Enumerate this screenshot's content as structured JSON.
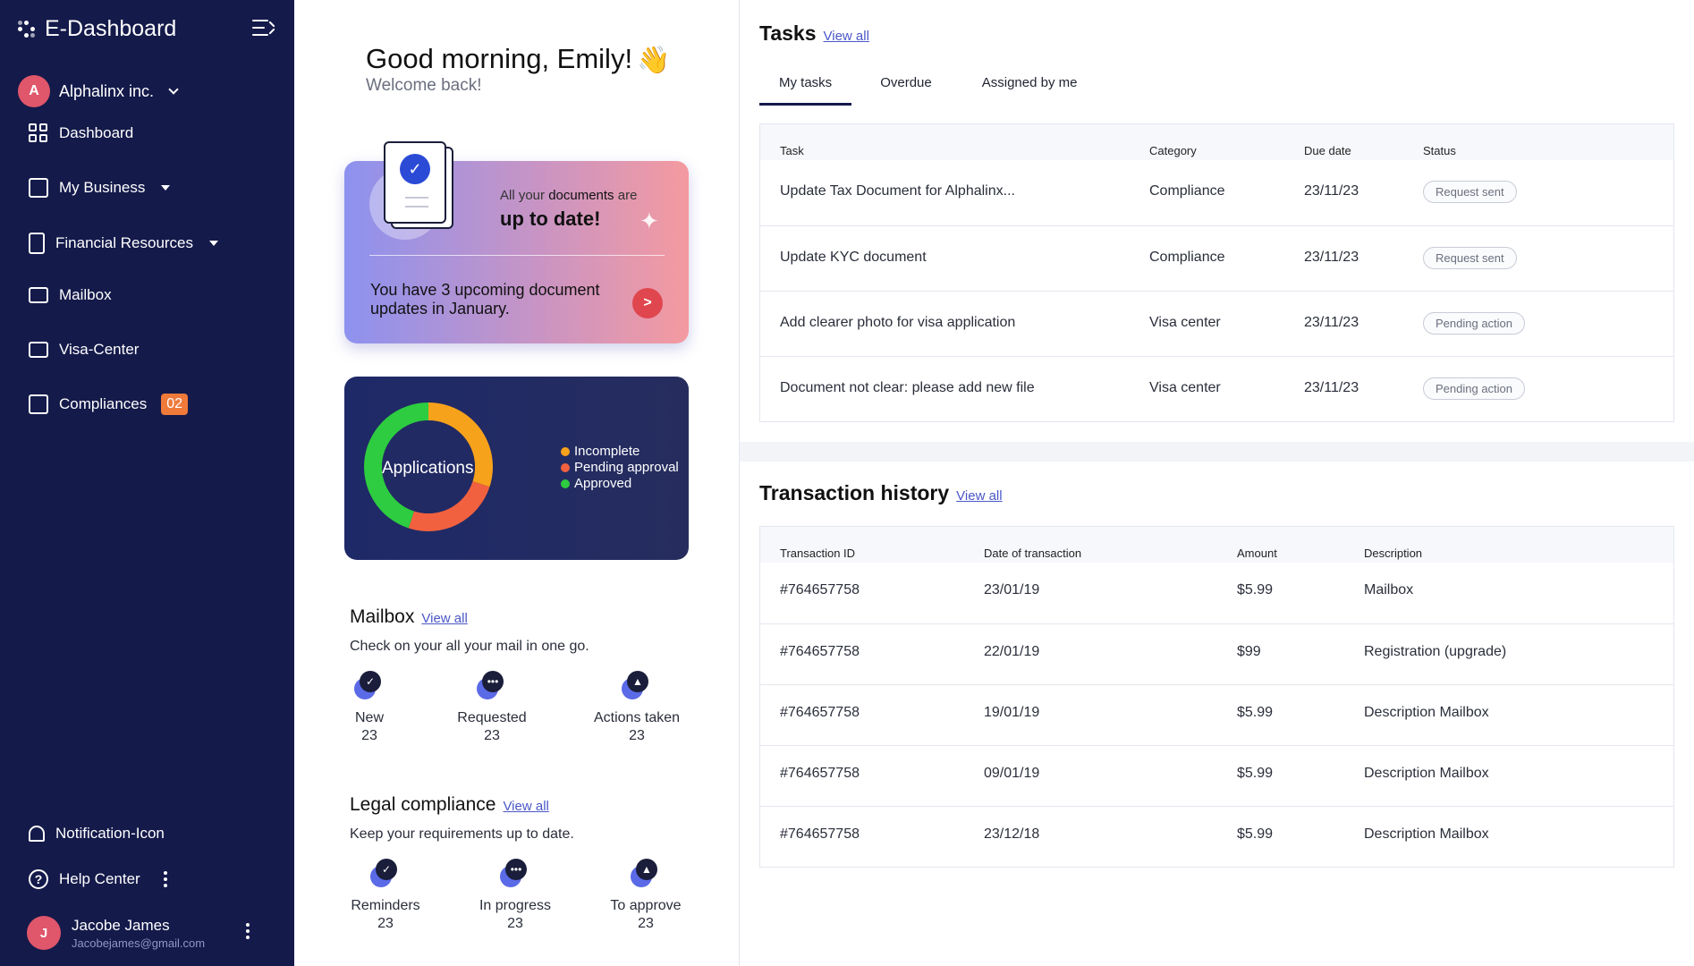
{
  "app": {
    "title": "E-Dashboard"
  },
  "org": {
    "initial": "A",
    "name": "Alphalinx inc."
  },
  "nav": [
    {
      "label": "Dashboard",
      "icon": "grid-icon"
    },
    {
      "label": "My Business",
      "icon": "chart-icon"
    },
    {
      "label": "Financial Resources",
      "icon": "dollar-doc-icon"
    },
    {
      "label": "Mailbox",
      "icon": "mail-icon"
    },
    {
      "label": "Visa-Center",
      "icon": "id-card-icon"
    },
    {
      "label": "Compliances",
      "icon": "clipboard-icon",
      "badge": "02"
    }
  ],
  "bottom_nav": {
    "notification": "Notification-Icon",
    "help": "Help Center"
  },
  "user": {
    "initial": "J",
    "name": "Jacobe James",
    "email": "Jacobejames@gmail.com"
  },
  "greeting": {
    "prefix": "Good morning, ",
    "name": "Emily!",
    "welcome": "Welcome back!",
    "emoji": "👋"
  },
  "doc_card": {
    "small_prefix": "All your ",
    "small_bold": "documents",
    "small_suffix": " are",
    "big": "up to date!",
    "text": "You have 3 upcoming document updates in January.",
    "go": ">"
  },
  "applications": {
    "title": "Applications",
    "legend": [
      {
        "label": "Incomplete",
        "color": "#f7a21b"
      },
      {
        "label": "Pending approval",
        "color": "#f2613f"
      },
      {
        "label": "Approved",
        "color": "#2ecc40"
      }
    ]
  },
  "chart_data": {
    "type": "pie",
    "title": "Applications",
    "categories": [
      "Incomplete",
      "Pending approval",
      "Approved"
    ],
    "values": [
      30,
      25,
      45
    ],
    "colors": [
      "#f7a21b",
      "#f2613f",
      "#2ecc40"
    ]
  },
  "mailbox": {
    "title": "Mailbox",
    "view_all": "View all",
    "subtitle": "Check on your all your mail in one go.",
    "stats": [
      {
        "label": "New",
        "value": "23",
        "icon": "check-badge-icon"
      },
      {
        "label": "Requested",
        "value": "23",
        "icon": "chat-dots-icon"
      },
      {
        "label": "Actions taken",
        "value": "23",
        "icon": "bell-icon"
      }
    ]
  },
  "legal": {
    "title": "Legal compliance",
    "view_all": "View all",
    "subtitle": "Keep your requirements up to date.",
    "stats": [
      {
        "label": "Reminders",
        "value": "23",
        "icon": "check-badge-icon"
      },
      {
        "label": "In progress",
        "value": "23",
        "icon": "chat-dots-icon"
      },
      {
        "label": "To approve",
        "value": "23",
        "icon": "bell-icon"
      }
    ]
  },
  "tasks": {
    "title": "Tasks",
    "view_all": "View all",
    "tabs": [
      "My tasks",
      "Overdue",
      "Assigned by me"
    ],
    "columns": [
      "Task",
      "Category",
      "Due date",
      "Status"
    ],
    "rows": [
      {
        "task": "Update Tax Document for Alphalinx...",
        "category": "Compliance",
        "due": "23/11/23",
        "status": "Request sent"
      },
      {
        "task": "Update KYC document",
        "category": "Compliance",
        "due": "23/11/23",
        "status": "Request sent"
      },
      {
        "task": "Add clearer photo for visa application",
        "category": "Visa center",
        "due": "23/11/23",
        "status": "Pending action"
      },
      {
        "task": "Document not clear: please add new file",
        "category": "Visa center",
        "due": "23/11/23",
        "status": "Pending action"
      }
    ]
  },
  "transactions": {
    "title": "Transaction history",
    "view_all": "View all",
    "columns": [
      "Transaction ID",
      "Date of transaction",
      "Amount",
      "Description"
    ],
    "rows": [
      {
        "id": "#764657758",
        "date": "23/01/19",
        "amount": "$5.99",
        "desc": "Mailbox"
      },
      {
        "id": "#764657758",
        "date": "22/01/19",
        "amount": "$99",
        "desc": "Registration (upgrade)"
      },
      {
        "id": "#764657758",
        "date": "19/01/19",
        "amount": "$5.99",
        "desc": "Description Mailbox"
      },
      {
        "id": "#764657758",
        "date": "09/01/19",
        "amount": "$5.99",
        "desc": "Description Mailbox"
      },
      {
        "id": "#764657758",
        "date": "23/12/18",
        "amount": "$5.99",
        "desc": "Description Mailbox"
      }
    ]
  }
}
